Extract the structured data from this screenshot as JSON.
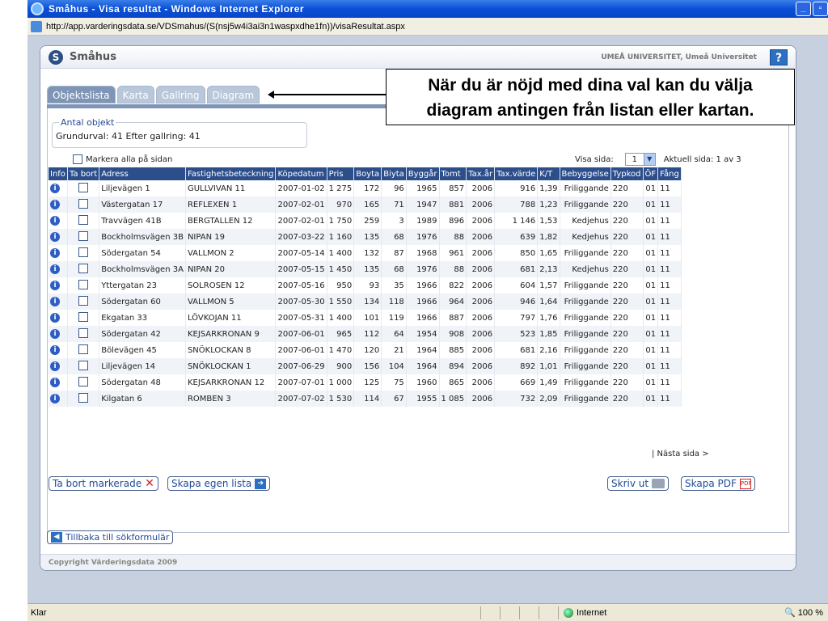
{
  "window": {
    "title": "Småhus - Visa resultat - Windows Internet Explorer",
    "address": "http://app.varderingsdata.se/VDSmahus/(S(nsj5w4i3ai3n1waspxdhe1fn))/visaResultat.aspx",
    "min_label": "_",
    "max_label": "▫",
    "status_left": "Klar",
    "zone": "Internet",
    "zoom": "100 %"
  },
  "app": {
    "logo_letter": "S",
    "title": "Småhus",
    "university": "UMEÅ UNIVERSITET, Umeå Universitet",
    "help_label": "?"
  },
  "tabs": [
    "Objektslista",
    "Karta",
    "Gallring",
    "Diagram"
  ],
  "callout": {
    "line1": "När du är nöjd med dina val kan du välja",
    "line2": "diagram antingen från listan eller kartan."
  },
  "counts": {
    "legend": "Antal objekt",
    "text": "Grundurval: 41  Efter gallring: 41"
  },
  "markall_label": "Markera alla på sidan",
  "pager": {
    "show_label": "Visa sida:",
    "selected": "1",
    "current": "Aktuell sida: 1 av 3",
    "next": "| Nästa sida >"
  },
  "columns": [
    "Info",
    "Ta bort",
    "Adress",
    "Fastighetsbeteckning",
    "Köpedatum",
    "Pris",
    "Boyta",
    "Biyta",
    "Byggår",
    "Tomt",
    "Tax.år",
    "Tax.värde",
    "K/T",
    "Bebyggelse",
    "Typkod",
    "ÖF",
    "Fång"
  ],
  "rows": [
    [
      "Liljevägen 1",
      "GULLVIVAN 11",
      "2007-01-02",
      "1 275",
      "172",
      "96",
      "1965",
      "857",
      "2006",
      "916",
      "1,39",
      "Friliggande",
      "220",
      "01",
      "11"
    ],
    [
      "Västergatan 17",
      "REFLEXEN 1",
      "2007-02-01",
      "970",
      "165",
      "71",
      "1947",
      "881",
      "2006",
      "788",
      "1,23",
      "Friliggande",
      "220",
      "01",
      "11"
    ],
    [
      "Travvägen 41B",
      "BERGTALLEN 12",
      "2007-02-01",
      "1 750",
      "259",
      "3",
      "1989",
      "896",
      "2006",
      "1 146",
      "1,53",
      "Kedjehus",
      "220",
      "01",
      "11"
    ],
    [
      "Bockholmsvägen 3B",
      "NIPAN 19",
      "2007-03-22",
      "1 160",
      "135",
      "68",
      "1976",
      "88",
      "2006",
      "639",
      "1,82",
      "Kedjehus",
      "220",
      "01",
      "11"
    ],
    [
      "Södergatan 54",
      "VALLMON 2",
      "2007-05-14",
      "1 400",
      "132",
      "87",
      "1968",
      "961",
      "2006",
      "850",
      "1,65",
      "Friliggande",
      "220",
      "01",
      "11"
    ],
    [
      "Bockholmsvägen 3A",
      "NIPAN 20",
      "2007-05-15",
      "1 450",
      "135",
      "68",
      "1976",
      "88",
      "2006",
      "681",
      "2,13",
      "Kedjehus",
      "220",
      "01",
      "11"
    ],
    [
      "Yttergatan 23",
      "SOLROSEN 12",
      "2007-05-16",
      "950",
      "93",
      "35",
      "1966",
      "822",
      "2006",
      "604",
      "1,57",
      "Friliggande",
      "220",
      "01",
      "11"
    ],
    [
      "Södergatan 60",
      "VALLMON 5",
      "2007-05-30",
      "1 550",
      "134",
      "118",
      "1966",
      "964",
      "2006",
      "946",
      "1,64",
      "Friliggande",
      "220",
      "01",
      "11"
    ],
    [
      "Ekgatan 33",
      "LÖVKOJAN 11",
      "2007-05-31",
      "1 400",
      "101",
      "119",
      "1966",
      "887",
      "2006",
      "797",
      "1,76",
      "Friliggande",
      "220",
      "01",
      "11"
    ],
    [
      "Södergatan 42",
      "KEJSARKRONAN 9",
      "2007-06-01",
      "965",
      "112",
      "64",
      "1954",
      "908",
      "2006",
      "523",
      "1,85",
      "Friliggande",
      "220",
      "01",
      "11"
    ],
    [
      "Bölevägen 45",
      "SNÖKLOCKAN 8",
      "2007-06-01",
      "1 470",
      "120",
      "21",
      "1964",
      "885",
      "2006",
      "681",
      "2,16",
      "Friliggande",
      "220",
      "01",
      "11"
    ],
    [
      "Liljevägen 14",
      "SNÖKLOCKAN 1",
      "2007-06-29",
      "900",
      "156",
      "104",
      "1964",
      "894",
      "2006",
      "892",
      "1,01",
      "Friliggande",
      "220",
      "01",
      "11"
    ],
    [
      "Södergatan 48",
      "KEJSARKRONAN 12",
      "2007-07-01",
      "1 000",
      "125",
      "75",
      "1960",
      "865",
      "2006",
      "669",
      "1,49",
      "Friliggande",
      "220",
      "01",
      "11"
    ],
    [
      "Kilgatan 6",
      "ROMBEN 3",
      "2007-07-02",
      "1 530",
      "114",
      "67",
      "1955",
      "1 085",
      "2006",
      "732",
      "2,09",
      "Friliggande",
      "220",
      "01",
      "11"
    ]
  ],
  "buttons": {
    "remove_marked": "Ta bort markerade",
    "own_list": "Skapa egen lista",
    "print": "Skriv ut",
    "pdf": "Skapa PDF",
    "back": "Tillbaka till sökformulär"
  },
  "footer": "Copyright Värderingsdata 2009"
}
